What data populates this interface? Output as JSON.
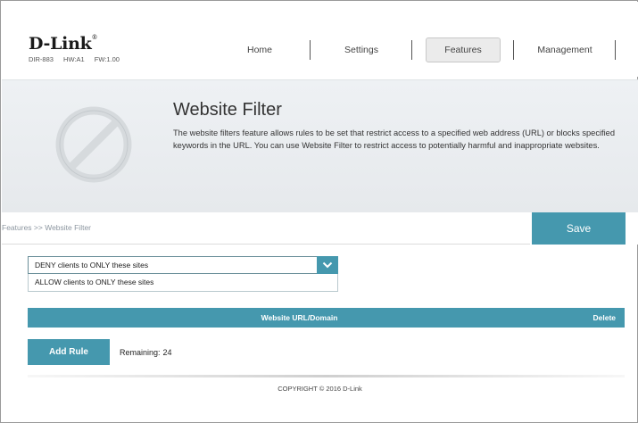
{
  "header": {
    "brand": "D-Link",
    "brand_reg": "®",
    "model": "DIR-883",
    "hw": "HW:A1",
    "fw": "FW:1.00"
  },
  "nav": {
    "items": [
      {
        "label": "Home",
        "active": false
      },
      {
        "label": "Settings",
        "active": false
      },
      {
        "label": "Features",
        "active": true
      },
      {
        "label": "Management",
        "active": false
      }
    ]
  },
  "banner": {
    "icon": "prohibited-icon",
    "title": "Website Filter",
    "description": "The website filters feature allows rules to be set that restrict access to a specified web address (URL) or blocks specified keywords in the URL. You can use Website Filter to restrict access to potentially harmful and inappropriate websites."
  },
  "breadcrumb": "Features >> Website Filter",
  "save_label": "Save",
  "filter_mode": {
    "selected": "DENY clients to ONLY these sites",
    "options": [
      "ALLOW clients to ONLY these sites"
    ],
    "icon": "chevron-down-icon"
  },
  "table": {
    "columns": [
      "Website URL/Domain",
      "Delete"
    ]
  },
  "add_rule_label": "Add Rule",
  "remaining": {
    "label": "Remaining:",
    "value": "24"
  },
  "copyright": "COPYRIGHT © 2016 D-Link",
  "colors": {
    "accent": "#4598ae"
  }
}
